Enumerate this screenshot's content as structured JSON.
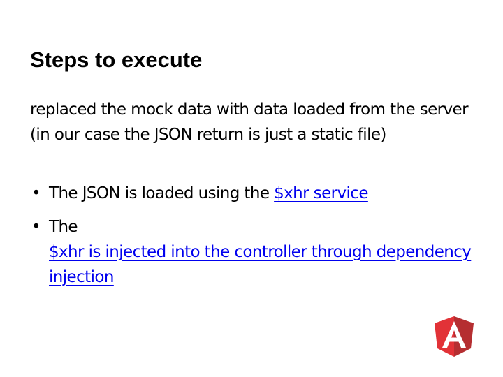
{
  "slide": {
    "title": "Steps to execute",
    "intro": "replaced the mock data with data loaded from the server (in our case the JSON return is just a static file)",
    "bullets": [
      {
        "text": "The JSON is loaded using the ",
        "link": "$xhr service"
      },
      {
        "text": "The",
        "link": "$xhr is injected into the controller through dependency injection"
      }
    ],
    "bullet_glyph": "•",
    "logo": {
      "icon": "angularjs-shield-icon",
      "letter": "A",
      "colors": {
        "left": "#e23237",
        "right": "#b52e31",
        "letter": "#ffffff"
      }
    },
    "colors": {
      "link": "#0000ee",
      "text": "#000000",
      "background": "#ffffff"
    }
  }
}
